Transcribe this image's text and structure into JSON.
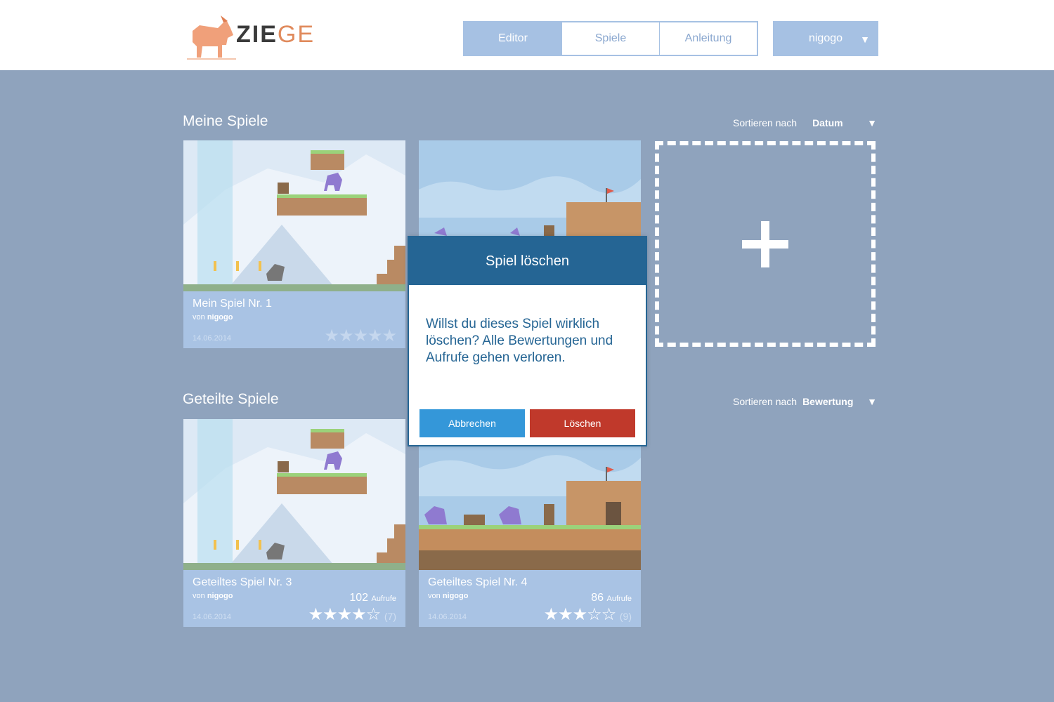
{
  "header": {
    "logo_text_bold": "ZIE",
    "logo_text_light": "GE",
    "nav": [
      {
        "label": "Editor",
        "active": true
      },
      {
        "label": "Spiele",
        "active": false
      },
      {
        "label": "Anleitung",
        "active": false
      }
    ],
    "user": {
      "name": "nigogo",
      "caret": "▼"
    }
  },
  "my_games": {
    "title": "Meine Spiele",
    "sort_label": "Sortieren nach",
    "sort_value": "Datum",
    "caret": "▼",
    "cards": [
      {
        "title": "Mein Spiel Nr. 1",
        "by": "von",
        "author": "nigogo",
        "date": "14.06.2014",
        "stars": "★★★★★"
      },
      {
        "title": "",
        "by": "",
        "author": "",
        "date": "",
        "stars": ""
      }
    ]
  },
  "shared_games": {
    "title": "Geteilte Spiele",
    "sort_label": "Sortieren nach",
    "sort_value": "Bewertung",
    "caret": "▼",
    "cards": [
      {
        "title": "Geteiltes Spiel Nr. 3",
        "by": "von",
        "author": "nigogo",
        "date": "14.06.2014",
        "views": "102",
        "views_label": "Aufrufe",
        "stars": "★★★★☆",
        "rating_count": "(7)"
      },
      {
        "title": "Geteiltes Spiel Nr. 4",
        "by": "von",
        "author": "nigogo",
        "date": "14.06.2014",
        "views": "86",
        "views_label": "Aufrufe",
        "stars": "★★★☆☆",
        "rating_count": "(9)"
      }
    ]
  },
  "modal": {
    "title": "Spiel löschen",
    "message": "Willst du dieses Spiel wirklich löschen? Alle Bewertungen und Aufrufe gehen verloren.",
    "cancel_label": "Abbrechen",
    "delete_label": "Löschen"
  },
  "colors": {
    "background": "#8fa3bd",
    "accent_blue": "#256594",
    "cancel_blue": "#3497d9",
    "delete_red": "#c0392b",
    "nav_blue": "#a6c1e3",
    "logo_orange": "#e08a5c"
  },
  "icons": {
    "add": "plus-icon",
    "caret": "chevron-down-icon",
    "goat": "goat-logo-icon"
  }
}
